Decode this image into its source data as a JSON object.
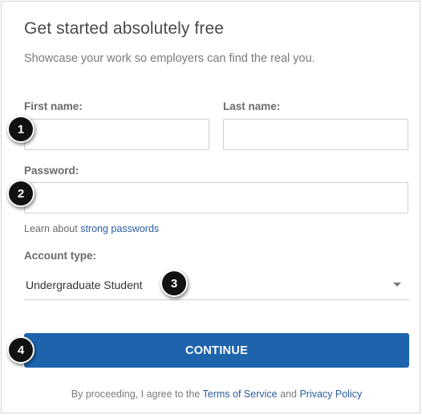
{
  "header": {
    "title": "Get started absolutely free",
    "subtitle": "Showcase your work so employers can find the real you."
  },
  "form": {
    "first_name_label": "First name:",
    "first_name_value": "",
    "last_name_label": "Last name:",
    "last_name_value": "",
    "password_label": "Password:",
    "password_value": "",
    "hint_prefix": "Learn about ",
    "hint_link": "strong passwords",
    "account_type_label": "Account type:",
    "account_type_value": "Undergraduate Student",
    "continue_label": "CONTINUE"
  },
  "legal": {
    "prefix": "By proceeding, I agree to the ",
    "terms_link": "Terms of Service",
    "and": " and ",
    "privacy_link": "Privacy Policy"
  },
  "callouts": [
    "1",
    "2",
    "3",
    "4"
  ],
  "colors": {
    "button": "#1e64ad",
    "link": "#2a5d9f",
    "badge": "#111111"
  }
}
